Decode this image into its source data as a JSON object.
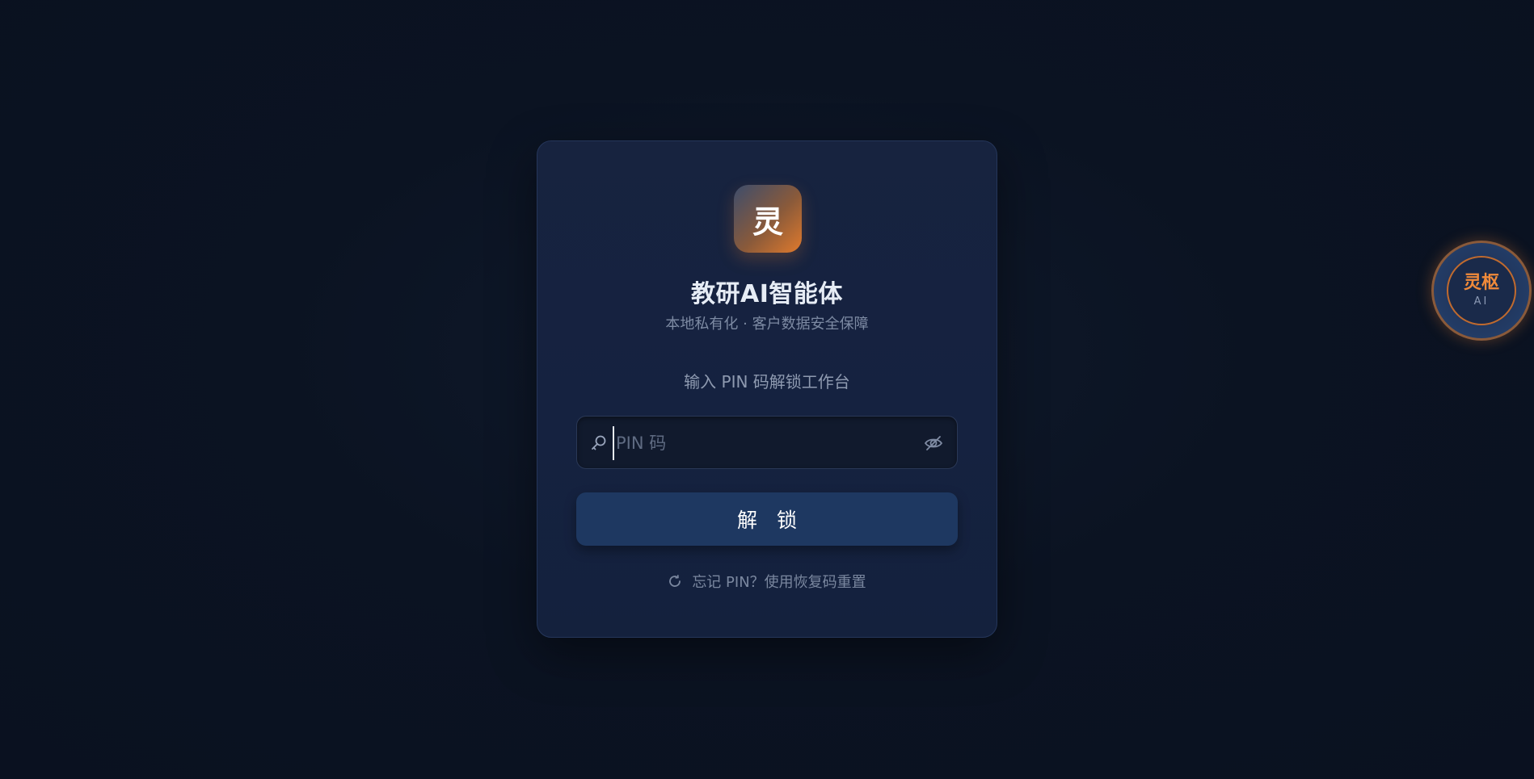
{
  "app": {
    "logo_char": "灵",
    "title": "教研AI智能体",
    "subtitle": "本地私有化 · 客户数据安全保障"
  },
  "unlock": {
    "prompt": "输入 PIN 码解锁工作台",
    "pin_placeholder": "PIN 码",
    "pin_value": "",
    "button_label": "解 锁",
    "forgot_link": "忘记 PIN？使用恢复码重置"
  },
  "assistant_badge": {
    "title": "灵枢",
    "sub": "AI"
  },
  "icons": {
    "pin_field": "key-icon",
    "toggle_visibility": "eye-off-icon",
    "forgot": "refresh-icon"
  },
  "colors": {
    "background": "#0b1322",
    "card": "#17233f",
    "button": "#1e3861",
    "accent": "#e07a2d"
  }
}
